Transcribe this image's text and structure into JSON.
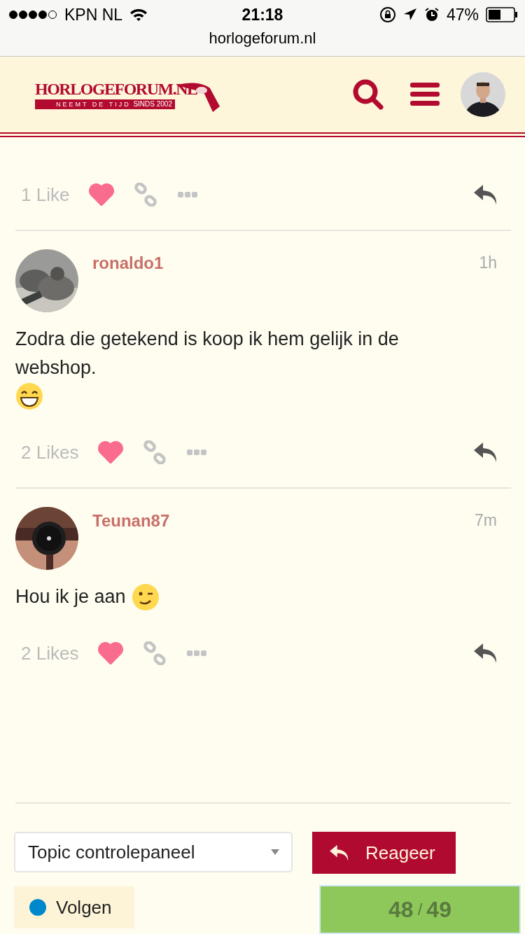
{
  "status_bar": {
    "carrier": "KPN NL",
    "time": "21:18",
    "battery": "47%"
  },
  "url_bar": {
    "address": "horlogeforum.nl"
  },
  "header": {
    "logo_title": "HORLOGEFORUM.NL",
    "logo_tagline": "NEEMT DE TIJD",
    "logo_since": "SINDS 2002"
  },
  "posts": [
    {
      "likes": "1 Like",
      "liked": true
    },
    {
      "author": "ronaldo1",
      "time": "1h",
      "lines": [
        [
          {
            "kind": "text",
            "text": "Zodra die getekend is koop ik hem gelijk in de webshop."
          }
        ],
        [
          {
            "kind": "grin"
          }
        ]
      ],
      "likes": "2 Likes",
      "liked": true
    },
    {
      "author": "Teunan87",
      "time": "7m",
      "lines": [
        [
          {
            "kind": "text",
            "text": "Hou ik je aan"
          },
          {
            "kind": "wink"
          }
        ]
      ],
      "likes": "2 Likes",
      "liked": true
    }
  ],
  "footer": {
    "dropdown": "Topic controlepaneel",
    "reply_button": "Reageer",
    "notification": {
      "label": "Volgen",
      "color": "#0088cc"
    },
    "progress": {
      "current": "48",
      "separator": "/",
      "total": "49"
    }
  }
}
